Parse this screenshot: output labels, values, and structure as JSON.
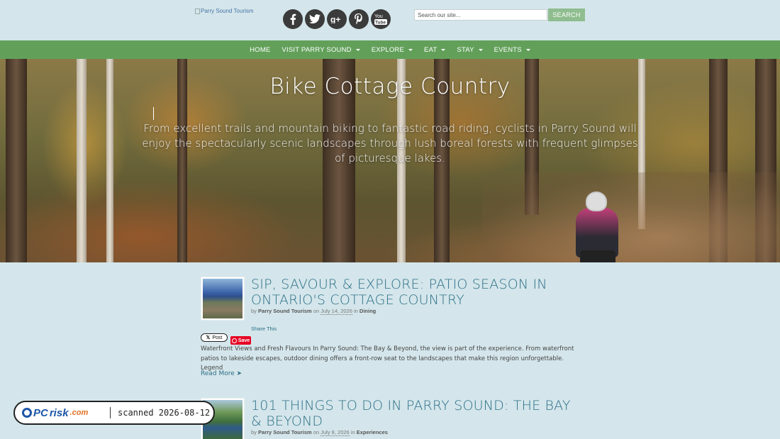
{
  "header": {
    "logo_alt": "Parry Sound Tourism",
    "social": [
      {
        "name": "facebook",
        "glyph": "f"
      },
      {
        "name": "twitter",
        "glyph": ""
      },
      {
        "name": "google-plus",
        "glyph": "g+"
      },
      {
        "name": "pinterest",
        "glyph": "P"
      },
      {
        "name": "youtube",
        "glyph": "You"
      }
    ],
    "search_placeholder": "Search our site...",
    "search_button": "SEARCH"
  },
  "nav": {
    "items": [
      {
        "label": "HOME",
        "dropdown": false
      },
      {
        "label": "VISIT PARRY SOUND",
        "dropdown": true
      },
      {
        "label": "EXPLORE",
        "dropdown": true
      },
      {
        "label": "EAT",
        "dropdown": true
      },
      {
        "label": "STAY",
        "dropdown": true
      },
      {
        "label": "EVENTS",
        "dropdown": true
      }
    ]
  },
  "hero": {
    "title": "Bike Cottage Country",
    "subtitle": "From excellent trails and mountain biking to fantastic road riding, cyclists in Parry Sound will enjoy the spectacularly scenic landscapes through lush boreal forests with frequent glimpses of picturesque lakes."
  },
  "posts": [
    {
      "title": "SIP, SAVOUR & EXPLORE: PATIO SEASON IN ONTARIO'S COTTAGE COUNTRY",
      "by": "by",
      "author": "Parry Sound Tourism",
      "on": "on",
      "date": "July 14, 2026",
      "in": "in",
      "category": "Dining",
      "share": "Share This",
      "x_post": "Post",
      "pin_save": "Save",
      "excerpt": "Waterfront Views and Fresh Flavours In Parry Sound: The Bay & Beyond, the view is part of the experience. From waterfront patios to lakeside escapes, outdoor dining offers a front-row seat to the landscapes that make this region unforgettable. Legend",
      "read_more": "Read More ➤"
    },
    {
      "title": "101 THINGS TO DO IN PARRY SOUND: THE BAY & BEYOND",
      "by": "by",
      "author": "Parry Sound Tourism",
      "on": "on",
      "date": "July 8, 2026",
      "in": "in",
      "category": "Experiences"
    }
  ],
  "watermark": {
    "brand_pc": "PC",
    "brand_risk": "risk",
    "brand_com": ".com",
    "scan_text": "scanned 2026-08-12"
  }
}
